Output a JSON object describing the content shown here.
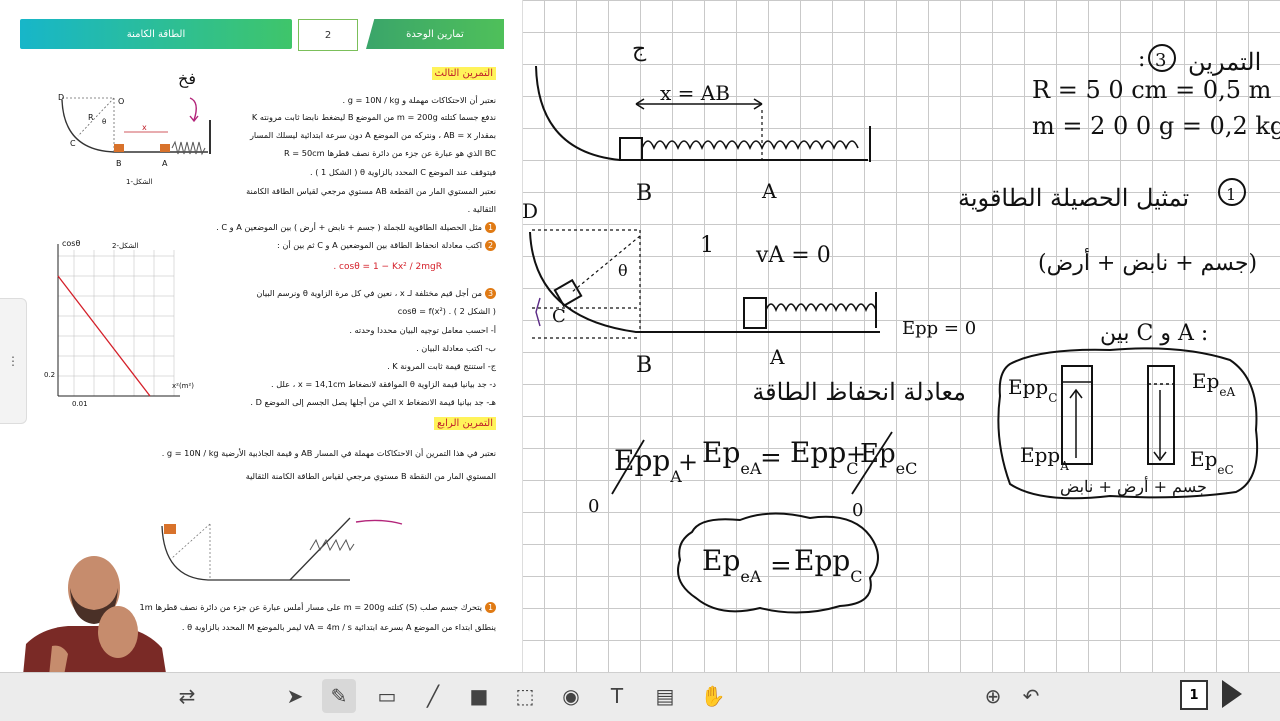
{
  "worksheet": {
    "header_right": "تمارين الوحدة",
    "header_page": "2",
    "header_left": "الطاقة الكامنة",
    "ex3_title": "التمرين الثالث",
    "ex3_lines": [
      "نعتبر أن الاحتكاكات مهملة و g = 10N / kg .",
      "ندفع جسما كتلته m = 200g من الموضع B ليضغط نابضا ثابت مرونته K",
      "بمقدار AB = x ، ونتركه من الموضع A دون سرعة ابتدائية ليسلك المسار",
      "BC الذي هو عبارة عن جزء من دائرة نصف قطرها R = 50cm",
      "فيتوقف عند الموضع C المحدد بالزاوية θ ( الشكل 1 ) .",
      "نعتبر المستوي المار من القطعة AB مستوي مرجعي لقياس الطاقة الكامنة",
      "الثقالية ."
    ],
    "ex3_q1": "مثل الحصيلة الطاقوية للجملة ( جسم + نابض + أرض ) بين الموضعين A و C .",
    "ex3_q2": "اكتب معادلة انحفاظ الطاقة بين الموضعين A و C ثم بين أن :",
    "ex3_formula": "cosθ = 1 − Kx² / 2mgR .",
    "ex3_q3": "من أجل قيم مختلفة لـ x ، نعين في كل مرة الزاوية θ ونرسم البيان",
    "ex3_q3b": "( الشكل 2 ) . cosθ = f(x²)",
    "ex3_qa": "أ- احسب معامل توجيه البيان محددا وحدته .",
    "ex3_qb": "ب- اكتب معادلة البيان .",
    "ex3_qc": "ج- استنتج قيمة ثابت المرونة K .",
    "ex3_qd": "د- جد بيانيا قيمة الزاوية θ الموافقة لانضغاط x = 14,1cm ، علل .",
    "ex3_qe": "هـ- جد بيانيا قيمة الانضغاط x التي من أجلها يصل الجسم إلى الموضع D .",
    "fig1_label": "الشكل-1",
    "fig2_label": "الشكل-2",
    "fig2_ylabel": "cosθ",
    "fig2_xlabel": "x²(m²)",
    "fig2_ytick": "0.2",
    "fig2_xtick": "0.01",
    "fig1_pts": {
      "D": "D",
      "O": "O",
      "R": "R",
      "C": "C",
      "B": "B",
      "A": "A",
      "x": "x",
      "theta": "θ"
    },
    "hand_note": "فخ",
    "ex4_title": "التمرين الرابع",
    "ex4_line1": "نعتبر في هذا التمرين أن الاحتكاكات مهملة في المسار AB و قيمة الجاذبية الأرضية g = 10N / kg .",
    "ex4_line2": "المستوي المار من النقطة B مستوي مرجعي لقياس الطاقة الكامنة الثقالية",
    "ex4_q1": "يتحرك جسم صلب (S) كتلته m = 200g على مسار أملس عبارة عن جزء من دائرة نصف قطرها 1m",
    "ex4_q1b": "ينطلق ابتداء من الموضع A بسرعة ابتدائية vA = 4m / s ليمر بالموضع M المحدد بالزاوية θ ."
  },
  "board": {
    "exercise_title": "التمرين",
    "exercise_num": "3",
    "r_given": "R = 5 0 cm = 0,5 m",
    "m_given": "m = 2 0 0 g = 0,2 kg",
    "q1_num": "1",
    "q1_text": "تمثيل الحصيلة الطاقوية",
    "q1_system": "(جسم + نابض + أرض)",
    "between": "بين C و A :",
    "x_ab": "x = AB",
    "va": "vA = 0",
    "epp0": "Epp = 0",
    "energy_cons": "معادلة انحفاظ الطاقة",
    "eq_lhs1": "Epp",
    "eq_lhs1_sub": "A",
    "eq_lhs2": "Ep",
    "eq_lhs2_sub": "eA",
    "eq_rhs1": "Epp",
    "eq_rhs1_sub": "C",
    "eq_rhs2": "Ep",
    "eq_rhs2_sub": "eC",
    "zero": "0",
    "result_lhs": "Ep",
    "result_lhs_sub": "eA",
    "result_rhs": "Epp",
    "result_rhs_sub": "C",
    "bar_epp_c": "Epp",
    "bar_epp_c_sub": "C",
    "bar_epp_a": "Epp",
    "bar_epp_a_sub": "A",
    "bar_epe_a": "Ep",
    "bar_epe_a_sub": "eA",
    "bar_epe_c": "Ep",
    "bar_epe_c_sub": "eC",
    "bar_caption": "جسم + أرض + نابض",
    "pt_B": "B",
    "pt_A": "A",
    "pt_D": "D",
    "pt_C": "C",
    "theta": "θ",
    "top_mark": "ج",
    "one": "1"
  },
  "toolbar": {
    "page_number": "1"
  },
  "colors": {
    "ink": "#111111",
    "purple_ink": "#5b2a86",
    "header_green": "#3fc56a",
    "header_teal": "#17b6c9",
    "highlight": "#fff35a",
    "accent_red": "#d4202a"
  }
}
